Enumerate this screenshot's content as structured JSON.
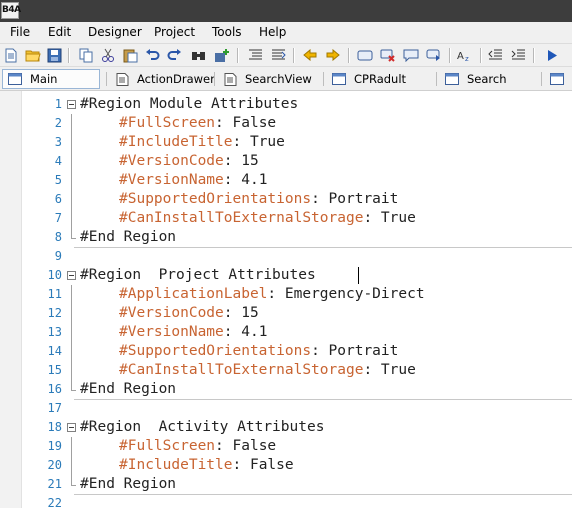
{
  "app": {
    "logo_text": "B4A"
  },
  "menu": [
    "File",
    "Edit",
    "Designer",
    "Project",
    "Tools",
    "Help"
  ],
  "toolbar": {
    "buttons": [
      "new-file-icon",
      "open-folder-icon",
      "save-icon",
      "copy-icon",
      "cut-icon",
      "paste-icon",
      "undo-icon",
      "redo-icon",
      "find-icon",
      "add-icon",
      "block-comment-icon",
      "uncomment-icon",
      "back-arrow-icon",
      "forward-arrow-icon",
      "designer-icon",
      "remove-icon",
      "chat-icon",
      "bookmark-icon",
      "font-icon",
      "outdent-icon",
      "indent-icon",
      "run-icon"
    ]
  },
  "tabs": [
    {
      "label": "Main",
      "active": true
    },
    {
      "label": "ActionDrawer",
      "active": false
    },
    {
      "label": "SearchView",
      "active": false
    },
    {
      "label": "CPRadult",
      "active": false
    },
    {
      "label": "Search",
      "active": false
    }
  ],
  "code_lines": [
    {
      "n": "1",
      "fold": "open",
      "text": "#Region Module Attributes"
    },
    {
      "n": "2",
      "fold": "mid",
      "attr": "#FullScreen",
      "value": "False"
    },
    {
      "n": "3",
      "fold": "mid",
      "attr": "#IncludeTitle",
      "value": "True"
    },
    {
      "n": "4",
      "fold": "mid",
      "attr": "#VersionCode",
      "value": "15"
    },
    {
      "n": "5",
      "fold": "mid",
      "attr": "#VersionName",
      "value": "4.1"
    },
    {
      "n": "6",
      "fold": "mid",
      "attr": "#SupportedOrientations",
      "value": "Portrait"
    },
    {
      "n": "7",
      "fold": "mid",
      "attr": "#CanInstallToExternalStorage",
      "value": "True"
    },
    {
      "n": "8",
      "fold": "close",
      "text": "#End Region"
    },
    {
      "n": "9",
      "fold": "none",
      "text": ""
    },
    {
      "n": "10",
      "fold": "open",
      "text": "#Region  Project Attributes "
    },
    {
      "n": "11",
      "fold": "mid",
      "attr": "#ApplicationLabel",
      "value": "Emergency-Direct"
    },
    {
      "n": "12",
      "fold": "mid",
      "attr": "#VersionCode",
      "value": "15"
    },
    {
      "n": "13",
      "fold": "mid",
      "attr": "#VersionName",
      "value": "4.1"
    },
    {
      "n": "14",
      "fold": "mid",
      "attr": "#SupportedOrientations",
      "value": "Portrait"
    },
    {
      "n": "15",
      "fold": "mid",
      "attr": "#CanInstallToExternalStorage",
      "value": "True"
    },
    {
      "n": "16",
      "fold": "close",
      "text": "#End Region"
    },
    {
      "n": "17",
      "fold": "none",
      "text": ""
    },
    {
      "n": "18",
      "fold": "open",
      "text": "#Region  Activity Attributes"
    },
    {
      "n": "19",
      "fold": "mid",
      "attr": "#FullScreen",
      "value": "False"
    },
    {
      "n": "20",
      "fold": "mid",
      "attr": "#IncludeTitle",
      "value": "False"
    },
    {
      "n": "21",
      "fold": "close",
      "text": "#End Region"
    },
    {
      "n": "22",
      "fold": "none",
      "text": ""
    }
  ],
  "colors": {
    "attribute": "#c86432",
    "line_number": "#2b7bb9",
    "titlebar": "#3d3d3d"
  }
}
